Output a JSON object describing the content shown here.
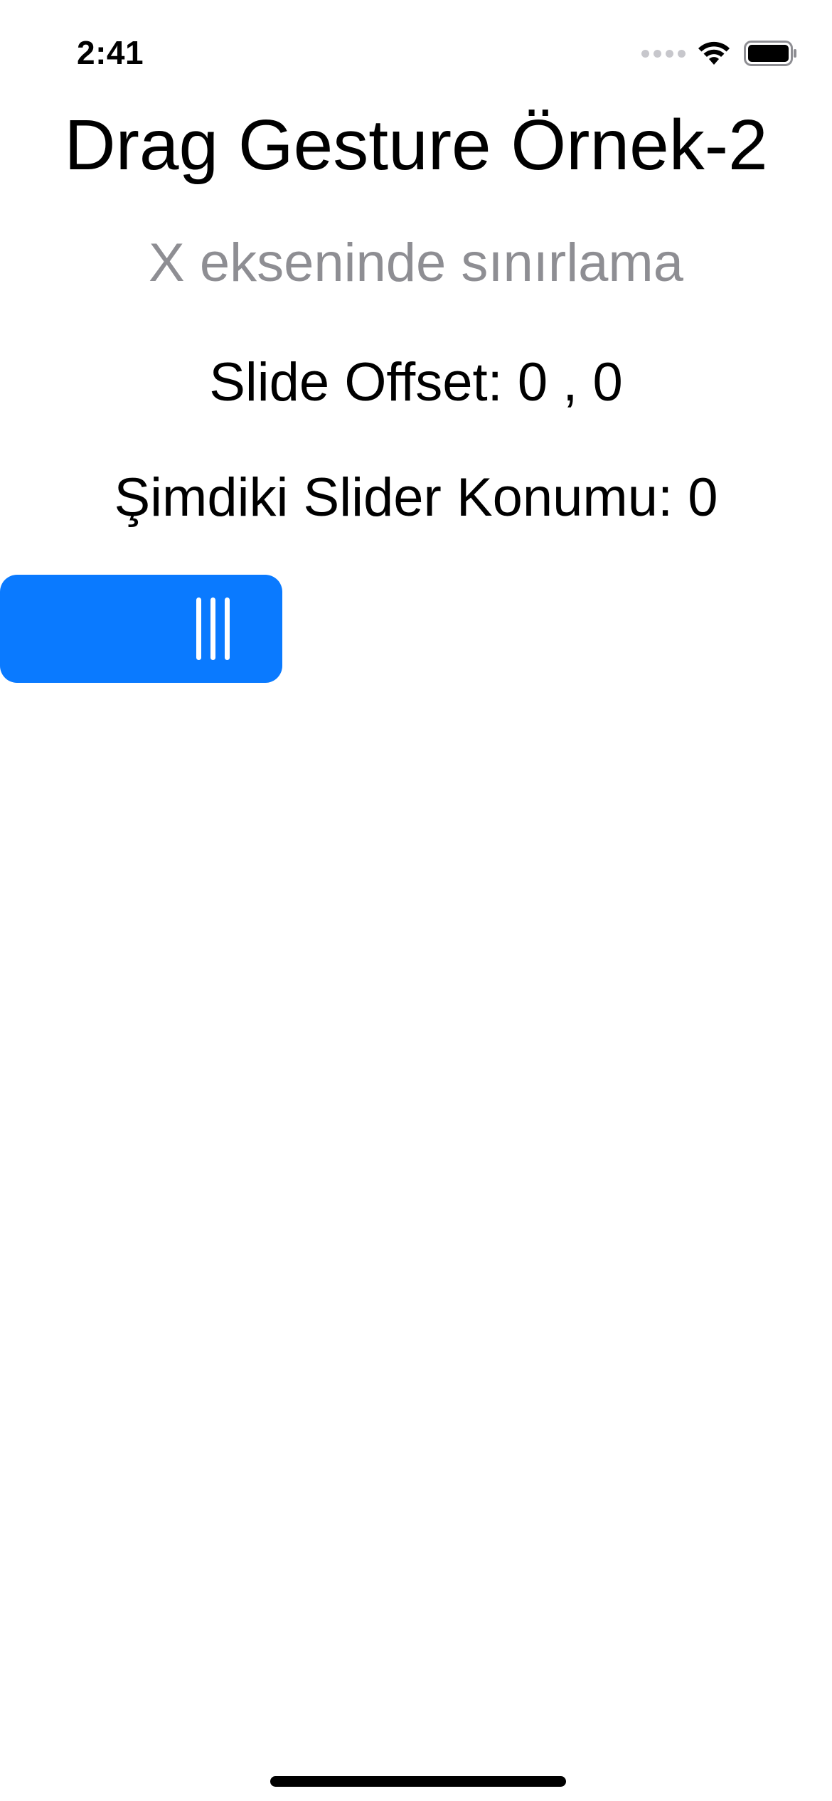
{
  "status_bar": {
    "time": "2:41",
    "icons": [
      "cellular-signal-icon",
      "wifi-icon",
      "battery-icon"
    ]
  },
  "main": {
    "title": "Drag Gesture Örnek-2",
    "subtitle": "X ekseninde sınırlama",
    "slide_offset": "Slide Offset: 0 , 0",
    "current_position": "Şimdiki Slider Konumu: 0"
  },
  "slider": {
    "grip_icon": "drag-grip-icon",
    "position": 0
  },
  "colors": {
    "accent": "#0a7aff",
    "secondary_text": "#8e8e93",
    "background": "#ffffff"
  }
}
